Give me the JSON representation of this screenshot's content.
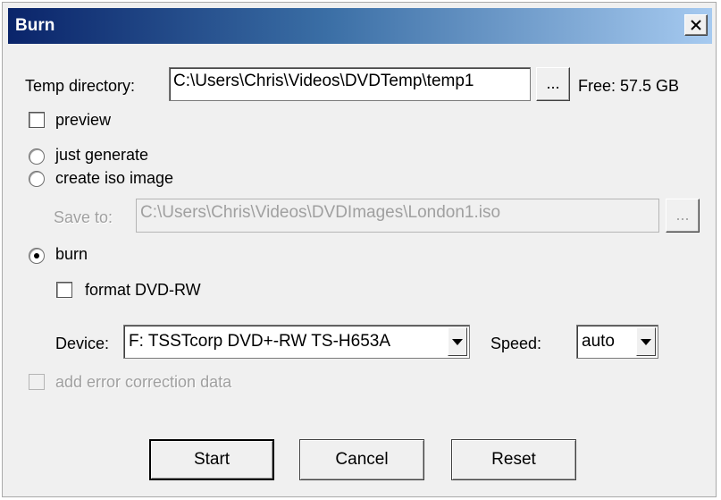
{
  "window": {
    "title": "Burn",
    "close_label": "×"
  },
  "temp": {
    "label": "Temp directory:",
    "value": "C:\\Users\\Chris\\Videos\\DVDTemp\\temp1",
    "browse_label": "...",
    "free_text": "Free: 57.5 GB"
  },
  "preview": {
    "label": "preview",
    "checked": false
  },
  "mode": {
    "options": [
      {
        "label": "just generate",
        "selected": false
      },
      {
        "label": "create iso image",
        "selected": false
      },
      {
        "label": "burn",
        "selected": true
      }
    ]
  },
  "save": {
    "label": "Save to:",
    "value": "C:\\Users\\Chris\\Videos\\DVDImages\\London1.iso",
    "browse_label": "...",
    "enabled": false
  },
  "format": {
    "label": "format DVD-RW",
    "checked": false
  },
  "device": {
    "label": "Device:",
    "value": "F: TSSTcorp DVD+-RW TS-H653A"
  },
  "speed": {
    "label": "Speed:",
    "value": "auto"
  },
  "error_correction": {
    "label": "add error correction data",
    "enabled": false,
    "checked": false
  },
  "buttons": {
    "start": "Start",
    "cancel": "Cancel",
    "reset": "Reset"
  }
}
